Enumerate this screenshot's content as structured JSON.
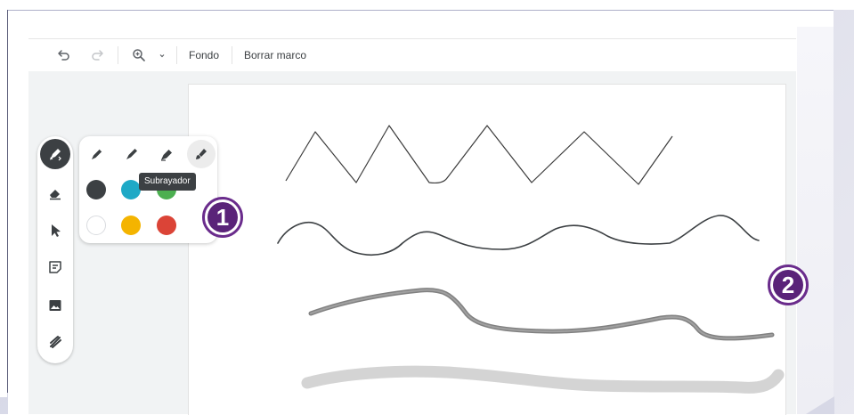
{
  "toolbar": {
    "undo_icon": "undo-icon",
    "redo_icon": "redo-icon",
    "zoom_icon": "zoom-in-icon",
    "zoom_dropdown_icon": "caret-down-icon",
    "background_label": "Fondo",
    "clear_frame_label": "Borrar marco"
  },
  "tool_rail": {
    "items": [
      {
        "icon": "pen-icon",
        "active": true
      },
      {
        "icon": "eraser-icon",
        "active": false
      },
      {
        "icon": "select-arrow-icon",
        "active": false
      },
      {
        "icon": "sticky-note-icon",
        "active": false
      },
      {
        "icon": "image-icon",
        "active": false
      },
      {
        "icon": "laser-icon",
        "active": false
      }
    ]
  },
  "pen_panel": {
    "pen_types": [
      {
        "icon": "pen-thin-icon"
      },
      {
        "icon": "marker-icon"
      },
      {
        "icon": "highlighter-icon"
      },
      {
        "icon": "brush-icon",
        "selected": true
      }
    ],
    "colors": [
      "#3c4043",
      "#1ea9c6",
      "#4caf50",
      "#ffffff",
      "#f4b400",
      "#db4437"
    ],
    "tooltip": "Subrayador"
  },
  "callouts": {
    "first": "1",
    "second": "2"
  },
  "colors": {
    "accent_purple": "#5a2379",
    "rail_active": "#3c4043",
    "workspace_bg": "#f1f3f4"
  }
}
